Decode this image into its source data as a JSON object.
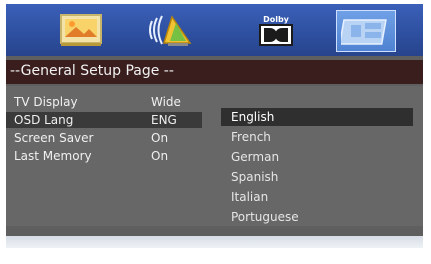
{
  "tabs": [
    {
      "icon": "picture-icon"
    },
    {
      "icon": "audio-speaker-icon"
    },
    {
      "icon": "dolby-icon",
      "label": "Dolby"
    },
    {
      "icon": "preferences-icon"
    }
  ],
  "page_title": "--General Setup Page --",
  "settings": [
    {
      "label": "TV Display",
      "value": "Wide"
    },
    {
      "label": "OSD Lang",
      "value": "ENG"
    },
    {
      "label": "Screen Saver",
      "value": "On"
    },
    {
      "label": "Last Memory",
      "value": "On"
    }
  ],
  "language_options": [
    "English",
    "French",
    "German",
    "Spanish",
    "Italian",
    "Portuguese"
  ],
  "colors": {
    "accent": "#2e4f9f",
    "title_bg": "#3a1d1d",
    "panel_bg": "#676767"
  }
}
